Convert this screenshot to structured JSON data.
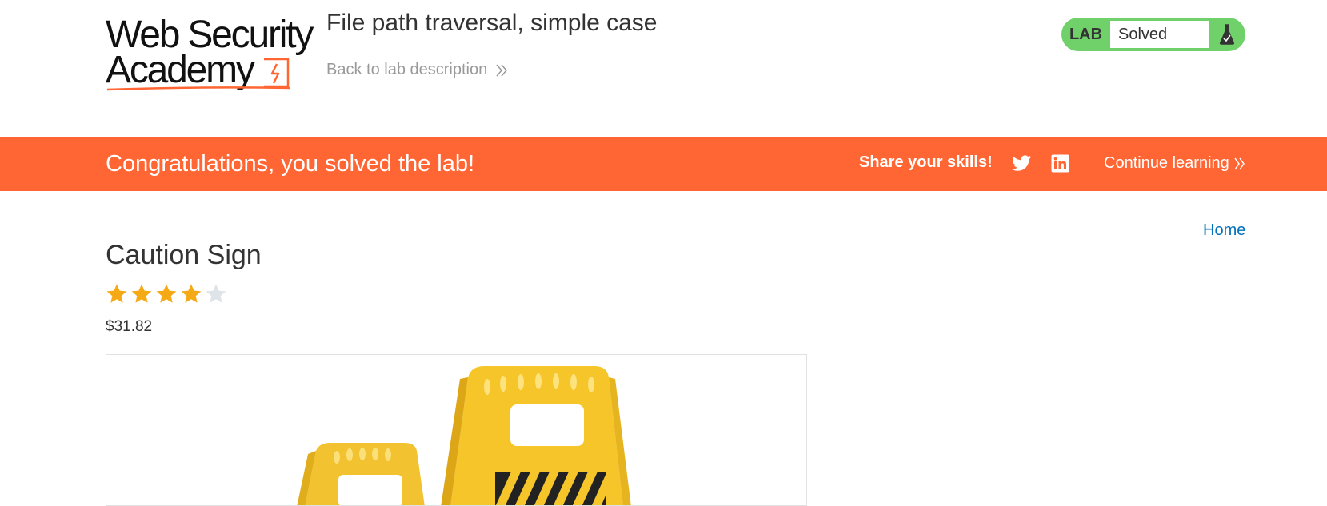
{
  "header": {
    "logo_line1": "Web Security",
    "logo_line2": "Academy",
    "lab_title": "File path traversal, simple case",
    "back_link": "Back to lab description",
    "lab_badge": {
      "label": "LAB",
      "status": "Solved",
      "color": "#70d16a"
    }
  },
  "banner": {
    "message": "Congratulations, you solved the lab!",
    "share_label": "Share your skills!",
    "continue_label": "Continue learning",
    "background": "#ff6633"
  },
  "nav": {
    "home_label": "Home"
  },
  "product": {
    "title": "Caution Sign",
    "rating": 4,
    "rating_max": 5,
    "price": "$31.82"
  },
  "icons": [
    "chevron-double-right-icon",
    "flask-icon",
    "twitter-icon",
    "linkedin-icon",
    "star-icon"
  ]
}
